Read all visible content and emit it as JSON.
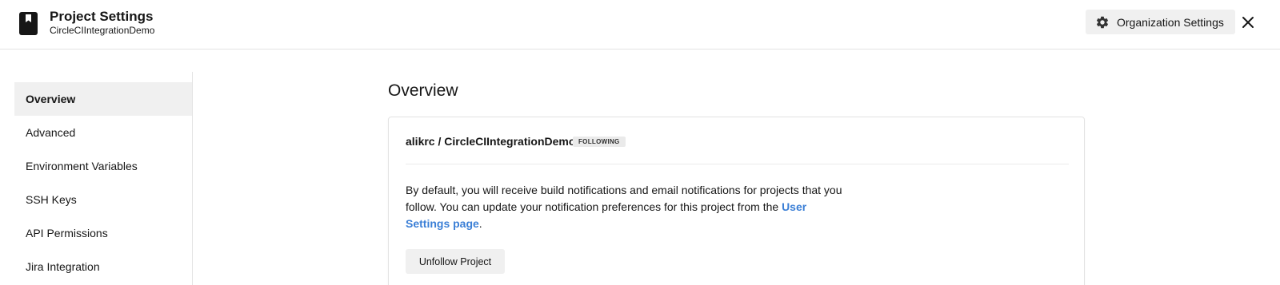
{
  "header": {
    "title": "Project Settings",
    "subtitle": "CircleCIIntegrationDemo",
    "org_settings_label": "Organization Settings",
    "brand_icon": "bookmark-book-icon",
    "org_icon": "gear-icon",
    "close_icon": "close-icon"
  },
  "sidebar": {
    "items": [
      {
        "label": "Overview",
        "active": true
      },
      {
        "label": "Advanced",
        "active": false
      },
      {
        "label": "Environment Variables",
        "active": false
      },
      {
        "label": "SSH Keys",
        "active": false
      },
      {
        "label": "API Permissions",
        "active": false
      },
      {
        "label": "Jira Integration",
        "active": false
      }
    ]
  },
  "main": {
    "title": "Overview",
    "card": {
      "repo": "alikrc / CircleCIIntegrationDemo",
      "badge": "FOLLOWING",
      "desc_text": "By default, you will receive build notifications and email notifications for projects that you follow. You can update your notification preferences for this project from the ",
      "link_text": "User Settings page",
      "desc_end": ".",
      "unfollow_label": "Unfollow Project"
    }
  },
  "colors": {
    "link": "#3b7fd6",
    "button_bg": "#f0f0f0",
    "active_bg": "#f0f0f0",
    "border": "#e3e3e3"
  }
}
